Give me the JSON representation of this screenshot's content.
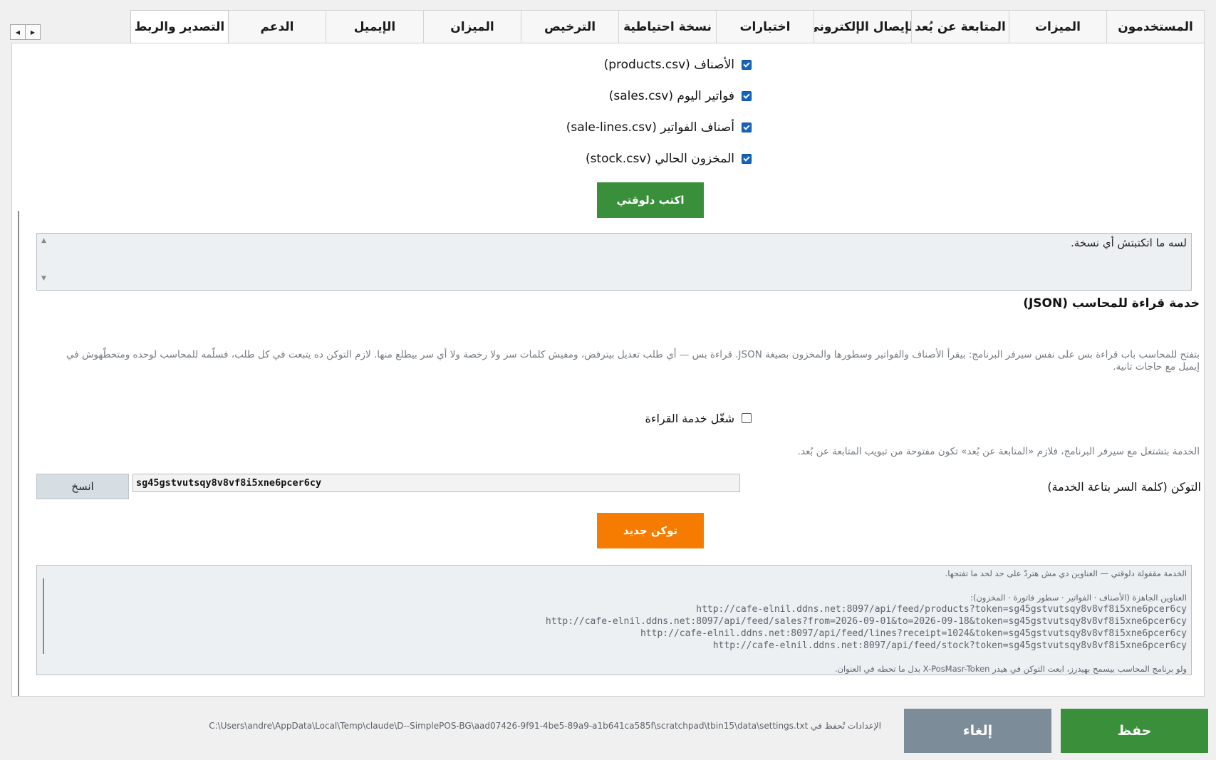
{
  "tabs": [
    {
      "label": "المستخدمون",
      "active": false
    },
    {
      "label": "الميزات",
      "active": false
    },
    {
      "label": "المتابعة عن بُعد",
      "active": false
    },
    {
      "label": "الإيصال الإلكتروني",
      "active": false
    },
    {
      "label": "اختبارات",
      "active": false
    },
    {
      "label": "نسخة احتياطية",
      "active": false
    },
    {
      "label": "الترخيص",
      "active": false
    },
    {
      "label": "الميزان",
      "active": false
    },
    {
      "label": "الإيميل",
      "active": false
    },
    {
      "label": "الدعم",
      "active": false
    },
    {
      "label": "التصدير والربط",
      "active": true
    }
  ],
  "tab_scroll": {
    "left": "◀",
    "right": "▶"
  },
  "export": {
    "files": [
      {
        "label": "الأصناف (products.csv)",
        "checked": true
      },
      {
        "label": "فواتير اليوم (sales.csv)",
        "checked": true
      },
      {
        "label": "أصناف الفواتير (sale-lines.csv)",
        "checked": true
      },
      {
        "label": "المخزون الحالي (stock.csv)",
        "checked": true
      }
    ],
    "write_button": "اكتب دلوقتي",
    "status_text": "لسه ما اتكتبتش أي نسخة."
  },
  "feed": {
    "title": "خدمة قراءة للمحاسب (JSON)",
    "description": "بتفتح للمحاسب باب قراءة بس على نفس سيرفر البرنامج: بيقرأ الأصناف والفواتير وسطورها والمخزون بصيغة JSON. قراءة بس — أي طلب تعديل بيترفض، ومفيش كلمات سر ولا رخصة ولا أي سر بيطلع منها. لازم التوكن ده يتبعت في كل طلب، فسلّمه للمحاسب لوحده ومتحطّهوش في إيميل مع حاجات تانية.",
    "enable_label": "شغّل خدمة القراءة",
    "enabled": false,
    "note": "الخدمة بتشتغل مع سيرفر البرنامج، فلازم «المتابعة عن بُعد» تكون مفتوحة من تبويب المتابعة عن بُعد.",
    "token_label": "التوكن (كلمة السر بتاعة الخدمة)",
    "token_value": "sg45gstvutsqy8v8vf8i5xne6pcer6cy",
    "copy_button": "انسخ",
    "new_token_button": "توكن جديد",
    "info_status": "الخدمة مقفولة دلوقتي — العناوين دي مش هتردّ على حد لحد ما تفتحها.",
    "endpoints_header": "العناوين الجاهزة (الأصناف · الفواتير · سطور فاتورة · المخزون):",
    "endpoints": [
      "http://cafe-elnil.ddns.net:8097/api/feed/products?token=sg45gstvutsqy8v8vf8i5xne6pcer6cy",
      "http://cafe-elnil.ddns.net:8097/api/feed/sales?from=2026-09-01&to=2026-09-18&token=sg45gstvutsqy8v8vf8i5xne6pcer6cy",
      "http://cafe-elnil.ddns.net:8097/api/feed/lines?receipt=1024&token=sg45gstvutsqy8v8vf8i5xne6pcer6cy",
      "http://cafe-elnil.ddns.net:8097/api/feed/stock?token=sg45gstvutsqy8v8vf8i5xne6pcer6cy"
    ],
    "footer_note": "ولو برنامج المحاسب بيسمح بهيدرز، ابعت التوكن في هيدر X-PosMasr-Token بدل ما تحطه في العنوان."
  },
  "footer": {
    "settings_path": "الإعدادات تُحفظ في C:\\Users\\andre\\AppData\\Local\\Temp\\claude\\D--SimplePOS-BG\\aad07426-9f91-4be5-89a9-a1b641ca585f\\scratchpad\\tbin15\\data\\settings.txt",
    "cancel_button": "إلغاء",
    "save_button": "حفظ"
  },
  "colors": {
    "green": "#3a8f3a",
    "orange": "#f57c00",
    "slate": "#7d8c99",
    "checkbox_blue": "#1565c0"
  }
}
